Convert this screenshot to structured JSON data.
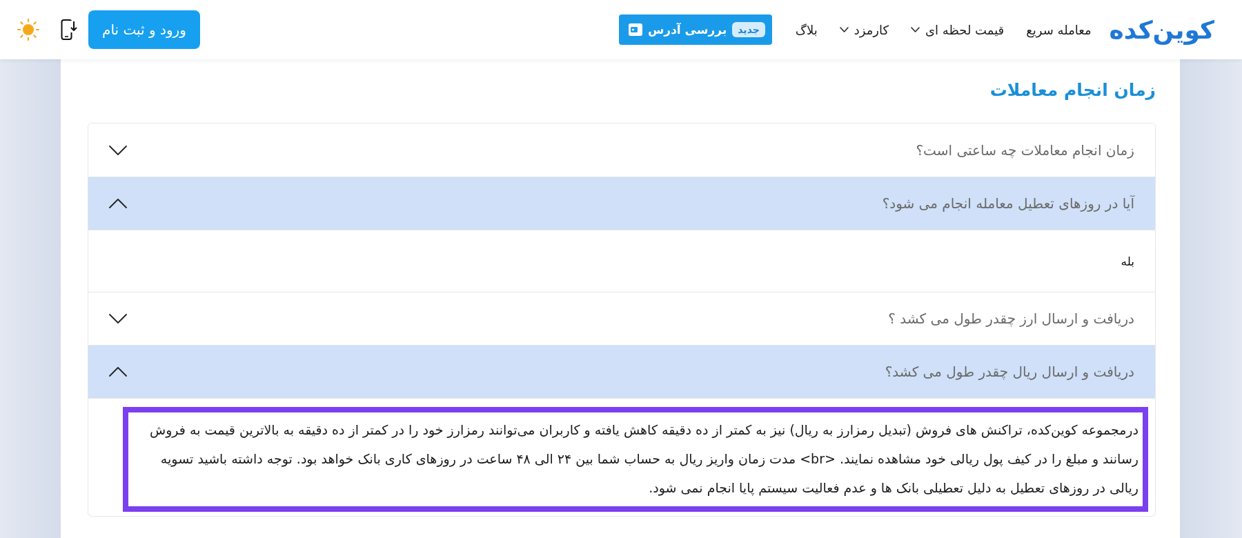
{
  "header": {
    "logo": "کوین‌کده",
    "nav": [
      {
        "label": "معامله سریع",
        "dropdown": false
      },
      {
        "label": "قیمت لحظه ای",
        "dropdown": true
      },
      {
        "label": "کارمزد",
        "dropdown": true
      },
      {
        "label": "بلاگ",
        "dropdown": false
      }
    ],
    "address_button": {
      "badge": "جدید",
      "label": "بررسی آدرس"
    },
    "login_button": "ورود و ثبت نام"
  },
  "section": {
    "title": "زمان انجام معاملات",
    "faq": [
      {
        "question": "زمان انجام معاملات چه ساعتی است؟",
        "expanded": false
      },
      {
        "question": "آیا در روزهای تعطیل معامله انجام می شود؟",
        "expanded": true,
        "answer": "بله",
        "highlighted": false
      },
      {
        "question": "دریافت و ارسال ارز چقدر طول می کشد ؟",
        "expanded": false
      },
      {
        "question": "دریافت و ارسال ریال چقدر طول می کشد؟",
        "expanded": true,
        "answer": "درمجموعه کوین‌کده، تراکنش های فروش (تبدیل رمزارز به ریال) نیز به کمتر از ده دقیقه کاهش یافته و کاربران می‌توانند رمزارز خود را در کمتر از ده دقیقه به بالاترین قیمت به فروش رسانند و مبلغ را در کیف پول ریالی خود مشاهده نمایند. <br> مدت زمان واریز ریال به حساب شما بین ۲۴ الی ۴۸ ساعت در روزهای کاری بانک خواهد بود. توجه داشته باشید تسویه ریالی در روزهای تعطیل به دلیل تعطیلی بانک ها و عدم فعالیت سیستم پایا انجام نمی شود.",
        "highlighted": true
      }
    ]
  }
}
